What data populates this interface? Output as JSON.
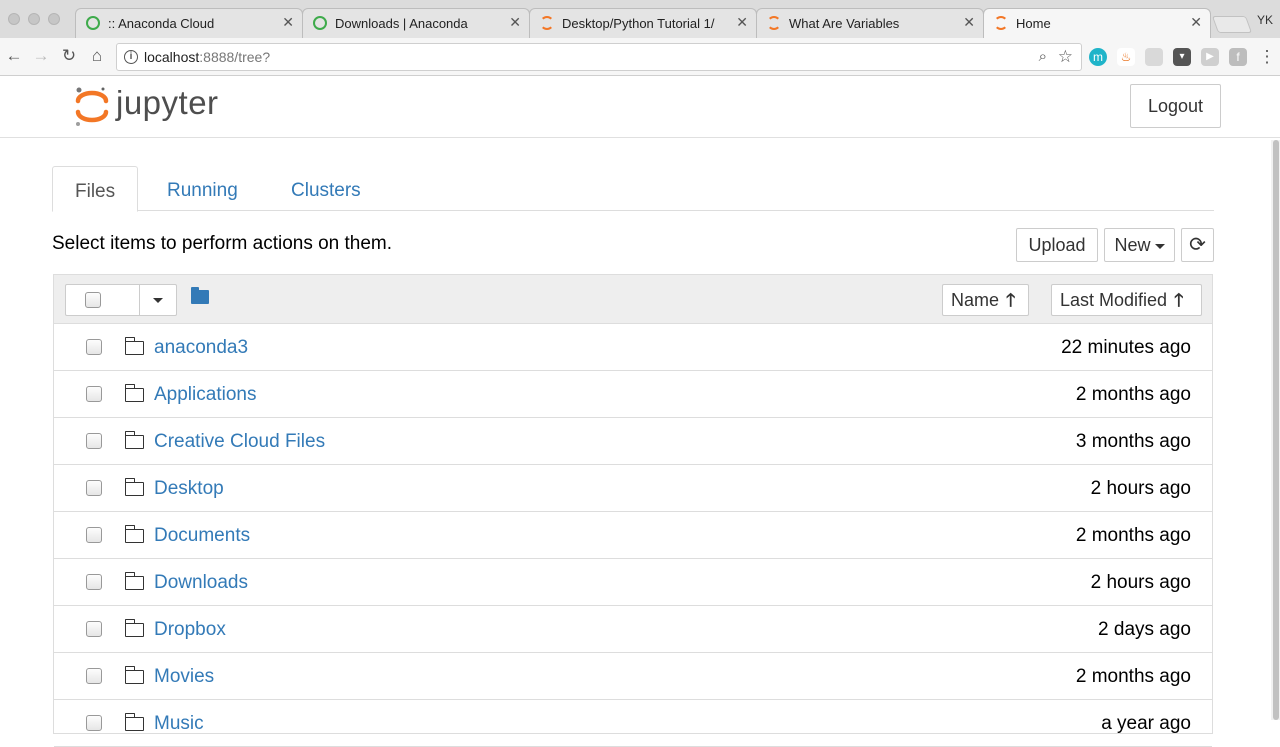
{
  "browser": {
    "tabs": [
      {
        "title": ":: Anaconda Cloud",
        "icon": "anaconda-green-icon"
      },
      {
        "title": "Downloads | Anaconda",
        "icon": "anaconda-green-icon"
      },
      {
        "title": "Desktop/Python Tutorial 1/",
        "icon": "jupyter-icon"
      },
      {
        "title": "What Are Variables",
        "icon": "jupyter-icon"
      },
      {
        "title": "Home",
        "icon": "jupyter-icon"
      }
    ],
    "close_glyph": "✕",
    "profile": "YK",
    "url_host": "localhost",
    "url_rest": ":8888/tree?"
  },
  "header": {
    "logo_text": "jupyter",
    "logout_label": "Logout"
  },
  "tabs": [
    "Files",
    "Running",
    "Clusters"
  ],
  "active_tab": "Files",
  "hint": "Select items to perform actions on them.",
  "actions": {
    "upload_label": "Upload",
    "new_label": "New",
    "refresh_glyph": "⟳"
  },
  "list": {
    "name_label": "Name",
    "modified_label": "Last Modified",
    "sort_glyph": "🡑",
    "rows": [
      {
        "name": "anaconda3",
        "modified": "22 minutes ago"
      },
      {
        "name": "Applications",
        "modified": "2 months ago"
      },
      {
        "name": "Creative Cloud Files",
        "modified": "3 months ago"
      },
      {
        "name": "Desktop",
        "modified": "2 hours ago"
      },
      {
        "name": "Documents",
        "modified": "2 months ago"
      },
      {
        "name": "Downloads",
        "modified": "2 hours ago"
      },
      {
        "name": "Dropbox",
        "modified": "2 days ago"
      },
      {
        "name": "Movies",
        "modified": "2 months ago"
      },
      {
        "name": "Music",
        "modified": "a year ago"
      }
    ]
  },
  "colors": {
    "link": "#337ab7",
    "jupyter_orange": "#f37726",
    "anaconda_green": "#3eab4b"
  }
}
